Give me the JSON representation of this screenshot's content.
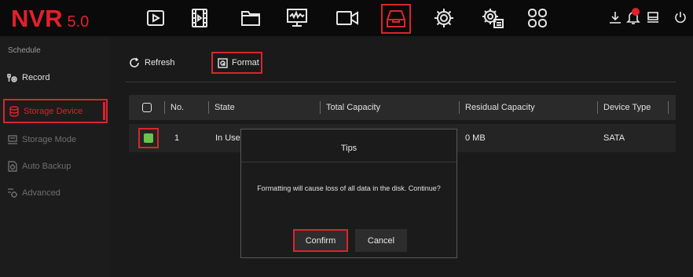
{
  "app": {
    "brand": "NVR",
    "version": "5.0"
  },
  "top_nav": [
    {
      "icon": "playback-icon"
    },
    {
      "icon": "video-clip-icon"
    },
    {
      "icon": "folder-icon"
    },
    {
      "icon": "monitor-icon"
    },
    {
      "icon": "camera-icon"
    },
    {
      "icon": "storage-icon",
      "active": true
    },
    {
      "icon": "gear-icon"
    },
    {
      "icon": "system-settings-icon"
    },
    {
      "icon": "apps-icon"
    }
  ],
  "status_icons": [
    "download-icon",
    "alarm-bell-icon",
    "display-icon",
    "power-icon"
  ],
  "sidebar": {
    "section_label": "Schedule",
    "items": [
      {
        "label": "Record",
        "icon": "record-schedule-icon"
      },
      {
        "label": "Storage Device",
        "icon": "database-icon",
        "active": true
      },
      {
        "label": "Storage Mode",
        "icon": "storage-mode-icon"
      },
      {
        "label": "Auto Backup",
        "icon": "backup-icon"
      },
      {
        "label": "Advanced",
        "icon": "advanced-icon"
      }
    ]
  },
  "toolbar": {
    "refresh_label": "Refresh",
    "format_label": "Format"
  },
  "table": {
    "columns": [
      "No.",
      "State",
      "Total Capacity",
      "Residual Capacity",
      "Device Type"
    ],
    "rows": [
      {
        "checked": true,
        "no": "1",
        "state": "In Use",
        "total": "",
        "residual": "0 MB",
        "type": "SATA"
      }
    ]
  },
  "dialog": {
    "title": "Tips",
    "message": "Formatting will cause loss of all data in the disk. Continue?",
    "confirm_label": "Confirm",
    "cancel_label": "Cancel"
  },
  "colors": {
    "accent": "#e3202a",
    "checkbox_checked": "#6cc24a",
    "background": "#1a1a1a"
  }
}
